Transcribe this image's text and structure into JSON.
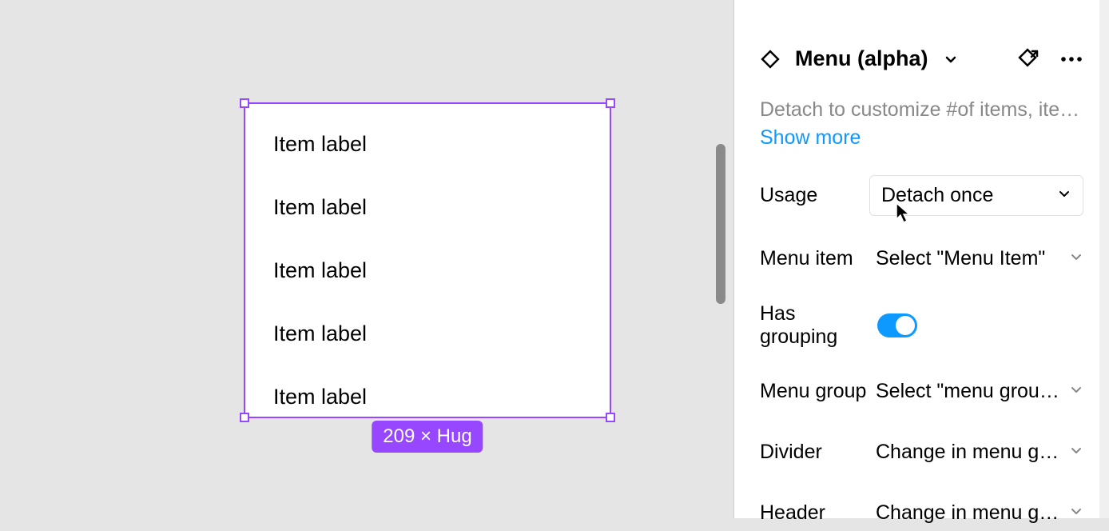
{
  "canvas": {
    "menu_items": [
      "Item label",
      "Item label",
      "Item label",
      "Item label",
      "Item label"
    ],
    "dimensions_badge": "209 × Hug"
  },
  "panel": {
    "component_name": "Menu (alpha)",
    "description": "Detach to customize #of items, item …",
    "show_more": "Show more",
    "properties": {
      "usage": {
        "label": "Usage",
        "value": "Detach once"
      },
      "menu_item": {
        "label": "Menu item",
        "value": "Select \"Menu Item\""
      },
      "has_grouping": {
        "label": "Has grouping",
        "value": true
      },
      "menu_group": {
        "label": "Menu group",
        "value": "Select \"menu grou…"
      },
      "divider": {
        "label": "Divider",
        "value": "Change in menu g…"
      },
      "header": {
        "label": "Header",
        "value": "Change in menu g…"
      }
    }
  },
  "colors": {
    "selection": "#9747ff",
    "link": "#0d99ff",
    "toggle_on": "#0d99ff"
  }
}
